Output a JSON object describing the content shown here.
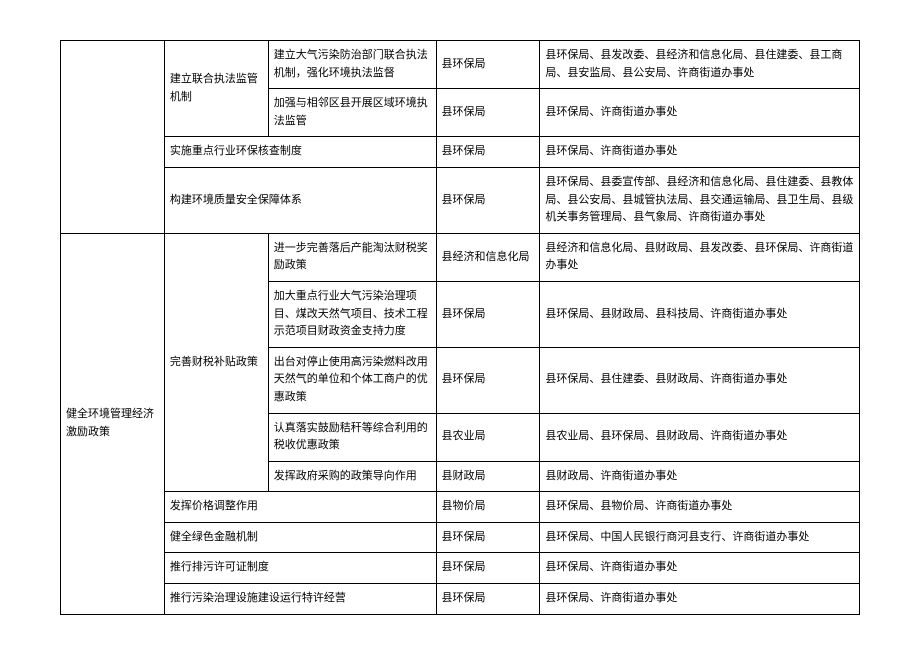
{
  "rows": [
    {
      "c1": "",
      "c2": "建立联合执法监管机制",
      "c3": "建立大气污染防治部门联合执法机制，强化环境执法监督",
      "c4": "县环保局",
      "c5": "县环保局、县发改委、县经济和信息化局、县住建委、县工商局、县安监局、县公安局、许商街道办事处"
    },
    {
      "c3": "加强与相邻区县开展区域环境执法监管",
      "c4": "县环保局",
      "c5": "县环保局、许商街道办事处"
    },
    {
      "c2": "实施重点行业环保核查制度",
      "c4": "县环保局",
      "c5": "县环保局、许商街道办事处"
    },
    {
      "c2": "构建环境质量安全保障体系",
      "c4": "县环保局",
      "c5": "县环保局、县委宣传部、县经济和信息化局、县住建委、县教体局、县公安局、县城管执法局、县交通运输局、县卫生局、县级机关事务管理局、县气象局、许商街道办事处"
    },
    {
      "c1": "健全环境管理经济激励政策",
      "c2": "完善财税补贴政策",
      "c3": "进一步完善落后产能淘汰财税奖励政策",
      "c4": "县经济和信息化局",
      "c5": "县经济和信息化局、县财政局、县发改委、县环保局、许商街道办事处"
    },
    {
      "c3": "加大重点行业大气污染治理项目、煤改天然气项目、技术工程示范项目财政资金支持力度",
      "c4": "县环保局",
      "c5": "县环保局、县财政局、县科技局、许商街道办事处"
    },
    {
      "c3": "出台对停止使用高污染燃料改用天然气的单位和个体工商户的优惠政策",
      "c4": "县环保局",
      "c5": "县环保局、县住建委、县财政局、许商街道办事处"
    },
    {
      "c3": "认真落实鼓励秸秆等综合利用的税收优惠政策",
      "c4": "县农业局",
      "c5": "县农业局、县环保局、县财政局、许商街道办事处"
    },
    {
      "c3": "发挥政府采购的政策导向作用",
      "c4": "县财政局",
      "c5": "县财政局、许商街道办事处"
    },
    {
      "c2": "发挥价格调整作用",
      "c4": "县物价局",
      "c5": "县环保局、县物价局、许商街道办事处"
    },
    {
      "c2": "健全绿色金融机制",
      "c4": "县环保局",
      "c5": "县环保局、中国人民银行商河县支行、许商街道办事处"
    },
    {
      "c2": "推行排污许可证制度",
      "c4": "县环保局",
      "c5": "县环保局、许商街道办事处"
    },
    {
      "c2": "推行污染治理设施建设运行特许经营",
      "c4": "县环保局",
      "c5": "县环保局、许商街道办事处"
    }
  ]
}
